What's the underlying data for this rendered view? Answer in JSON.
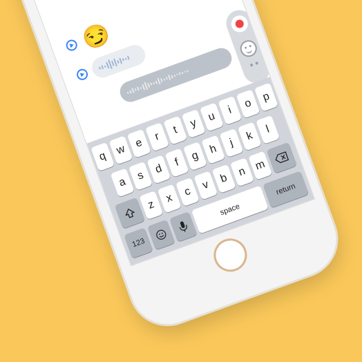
{
  "messages": [
    {
      "emoji": "😍"
    },
    {
      "emoji": "😏"
    }
  ],
  "keyboard": {
    "row1": [
      "q",
      "w",
      "e",
      "r",
      "t",
      "y",
      "u",
      "i",
      "o",
      "p"
    ],
    "row2": [
      "a",
      "s",
      "d",
      "f",
      "g",
      "h",
      "j",
      "k",
      "l"
    ],
    "row3": [
      "z",
      "x",
      "c",
      "v",
      "b",
      "n",
      "m"
    ],
    "numbers_label": "123",
    "space_label": "space",
    "return_label": "return"
  }
}
